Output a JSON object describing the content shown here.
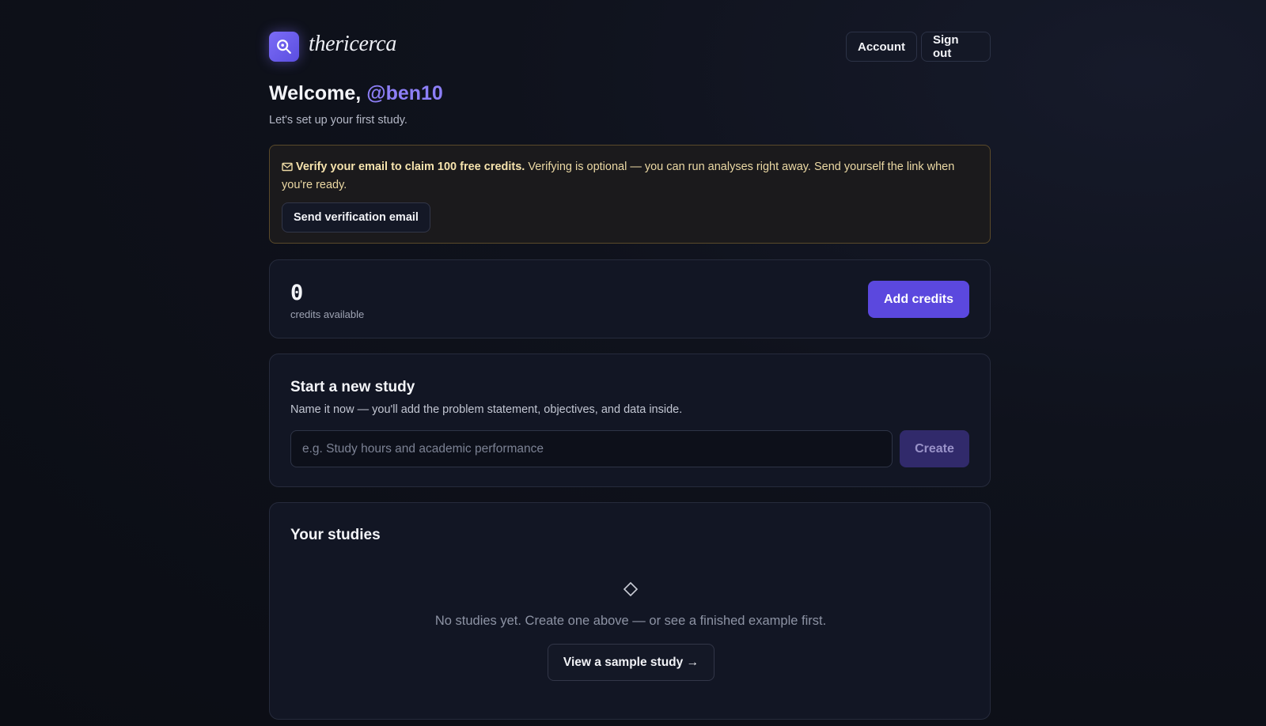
{
  "app": {
    "brand": "thericerca"
  },
  "header": {
    "account_label": "Account",
    "signout_label": "Sign out"
  },
  "welcome": {
    "prefix": "Welcome,",
    "username": "@ben10",
    "subtitle": "Let's set up your first study."
  },
  "verify": {
    "bold": "Verify your email to claim 100 free credits.",
    "text": " Verifying is optional — you can run analyses right away. Send yourself the link when you're ready.",
    "button_label": "Send verification email"
  },
  "credits": {
    "count": "0",
    "label": "credits available",
    "add_label": "Add credits"
  },
  "new_study": {
    "title": "Start a new study",
    "description": "Name it now — you'll add the problem statement, objectives, and data inside.",
    "placeholder": "e.g. Study hours and academic performance",
    "create_label": "Create"
  },
  "studies": {
    "title": "Your studies",
    "empty_text": "No studies yet. Create one above — or see a finished example first.",
    "sample_label": "View a sample study →"
  },
  "colors": {
    "accent": "#5b48de",
    "username": "#8d7ff7",
    "warning_border": "#5a4a2a"
  },
  "icons": {
    "logo": "search-icon",
    "verify": "mail-icon",
    "empty": "diamond-icon"
  }
}
